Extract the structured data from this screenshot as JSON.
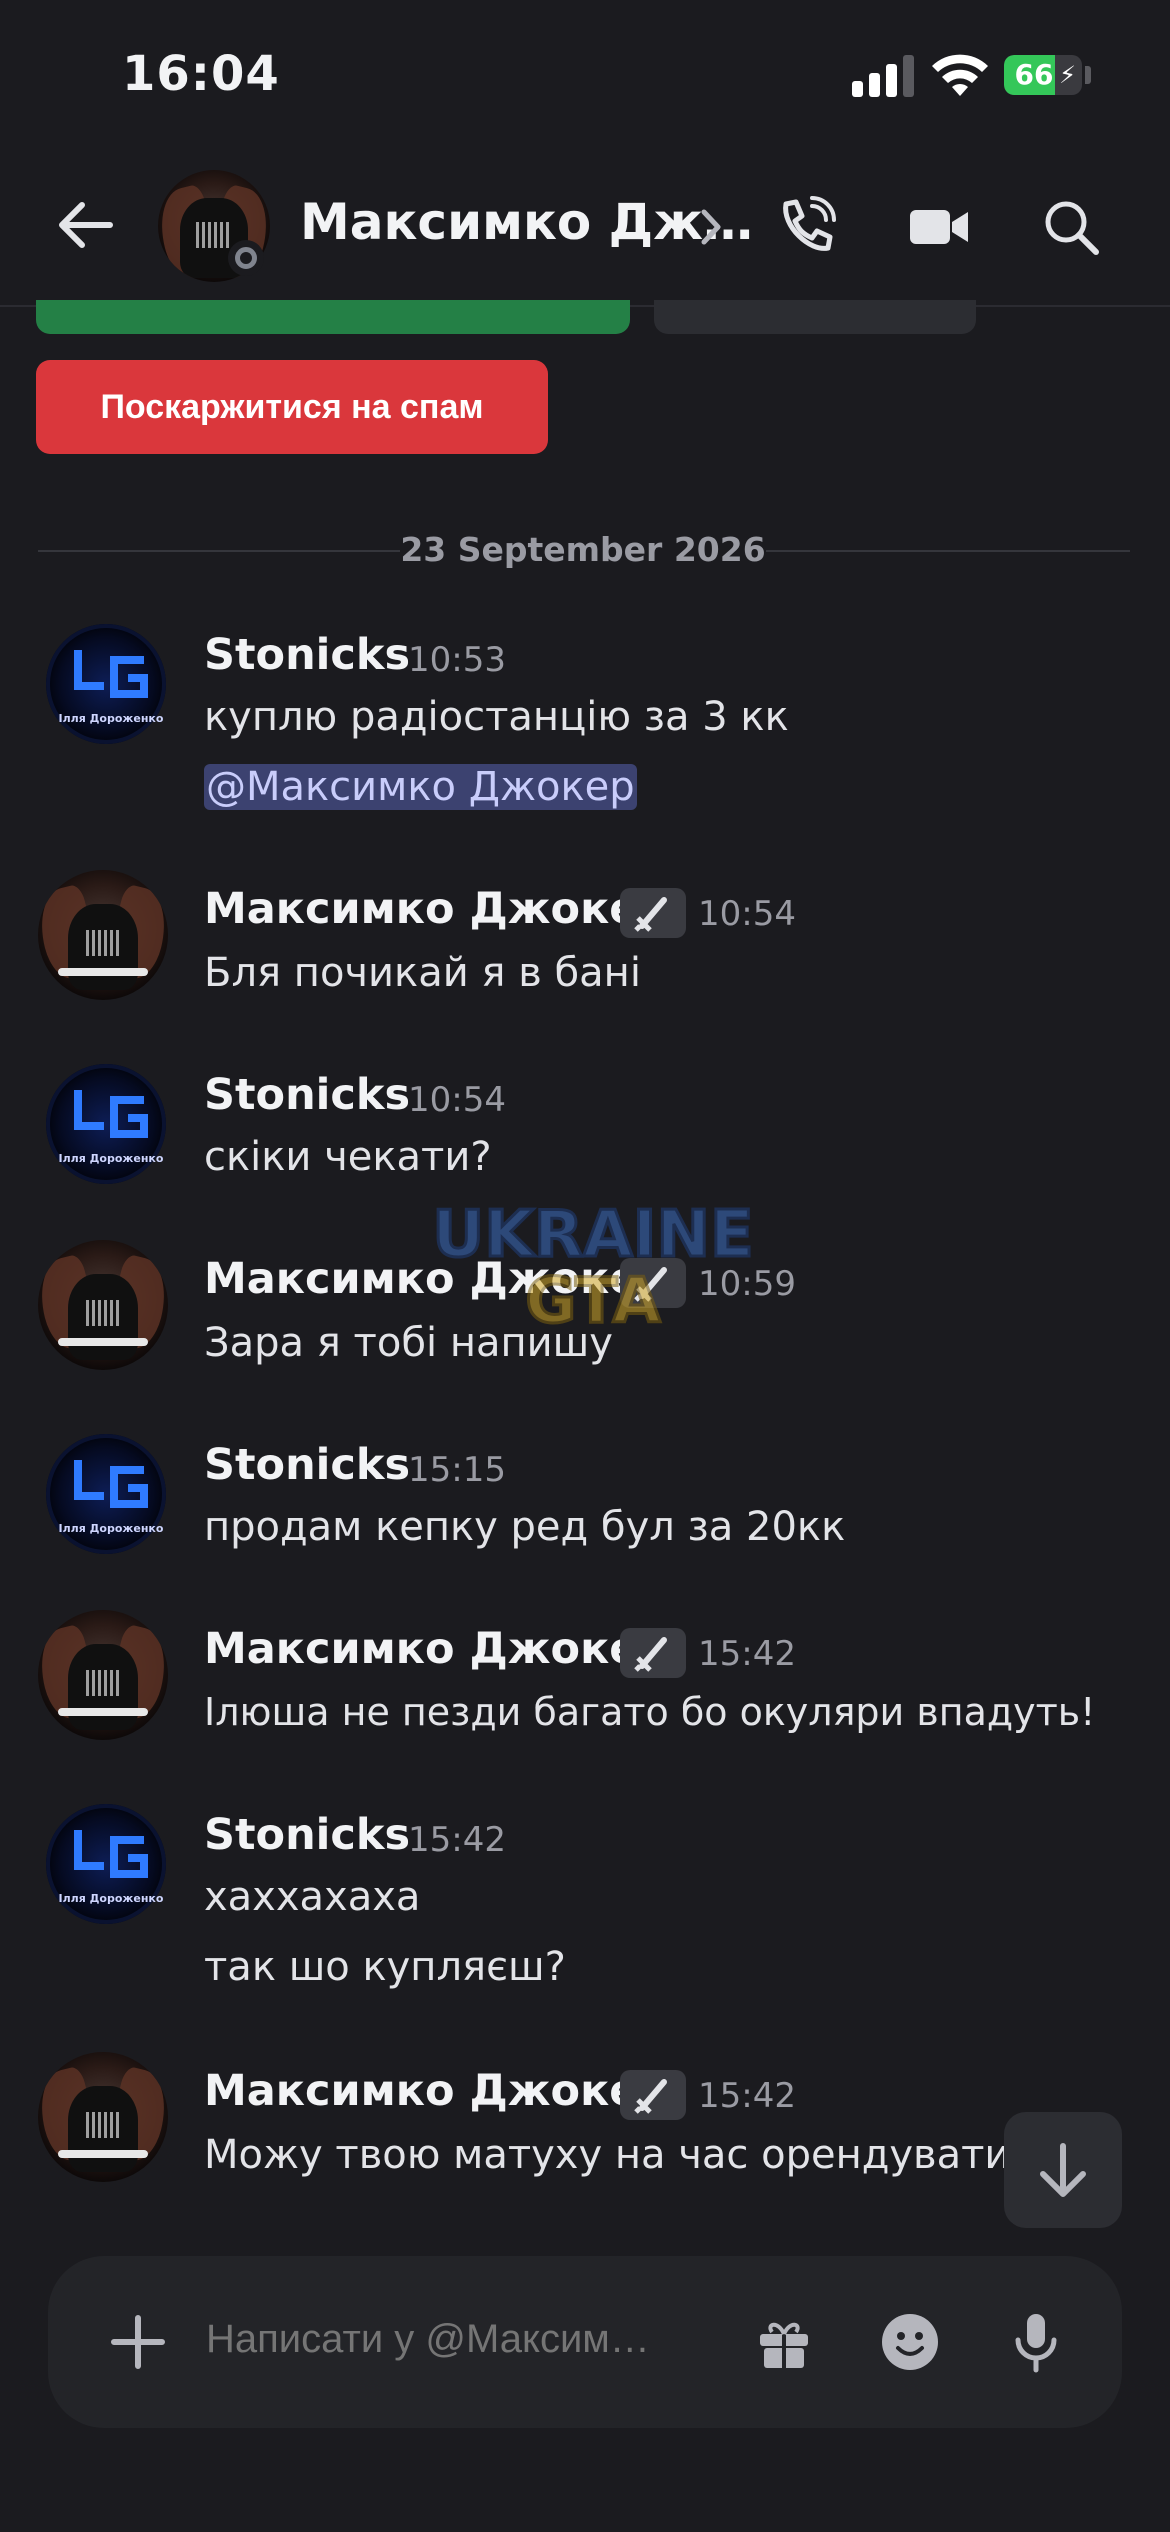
{
  "status_bar": {
    "time": "16:04",
    "battery": "66",
    "battery_level": 0.66,
    "icons": [
      "cellular-signal-icon",
      "wifi-icon",
      "battery-charging-icon"
    ]
  },
  "header": {
    "title": "Максимко Дж…",
    "icons": [
      "back-arrow-icon",
      "chevron-right-icon",
      "phone-call-icon",
      "video-camera-icon",
      "search-icon"
    ]
  },
  "actions": {
    "spam_label": "Поскаржитися на спам"
  },
  "date_divider": "23 September 2026",
  "messages": [
    {
      "author": "Stonicks",
      "time": "10:53",
      "lines": [
        "куплю радіостанцію за 3 кк"
      ],
      "mention": "@Максимко Джокер",
      "avatar_caption": "Ілля Дороженко"
    },
    {
      "author": "Максимко Джокер",
      "time": "10:54",
      "badge_icon": "sword-icon",
      "lines": [
        "Бля почикай я в бані"
      ]
    },
    {
      "author": "Stonicks",
      "time": "10:54",
      "lines": [
        "скіки чекати?"
      ],
      "avatar_caption": "Ілля Дороженко"
    },
    {
      "author": "Максимко Джокер",
      "time": "10:59",
      "badge_icon": "sword-icon",
      "lines": [
        "Зара я тобі напишу"
      ]
    },
    {
      "author": "Stonicks",
      "time": "15:15",
      "lines": [
        "продам кепку ред бул за 20кк"
      ],
      "avatar_caption": "Ілля Дороженко"
    },
    {
      "author": "Максимко Джокер",
      "time": "15:42",
      "badge_icon": "sword-icon",
      "lines": [
        "Ілюша не пезди багато бо окуляри впадуть!"
      ]
    },
    {
      "author": "Stonicks",
      "time": "15:42",
      "lines": [
        "хаххахаха",
        "так шо купляєш?"
      ],
      "avatar_caption": "Ілля Дороженко"
    },
    {
      "author": "Максимко Джокер",
      "time": "15:42",
      "badge_icon": "sword-icon",
      "lines": [
        "Можу твою матуху на час орендувати"
      ]
    }
  ],
  "watermark": {
    "line1": "UKRAINE",
    "line2": "GTA"
  },
  "composer": {
    "placeholder": "Написати у @Максим…",
    "icons": [
      "plus-icon",
      "gift-icon",
      "emoji-icon",
      "microphone-icon"
    ]
  },
  "colors": {
    "background": "#1b1b1f",
    "spam_button": "#da373c",
    "green_button": "#248046",
    "mention_bg": "#3c4270",
    "mention_text": "#c9cdfb"
  }
}
